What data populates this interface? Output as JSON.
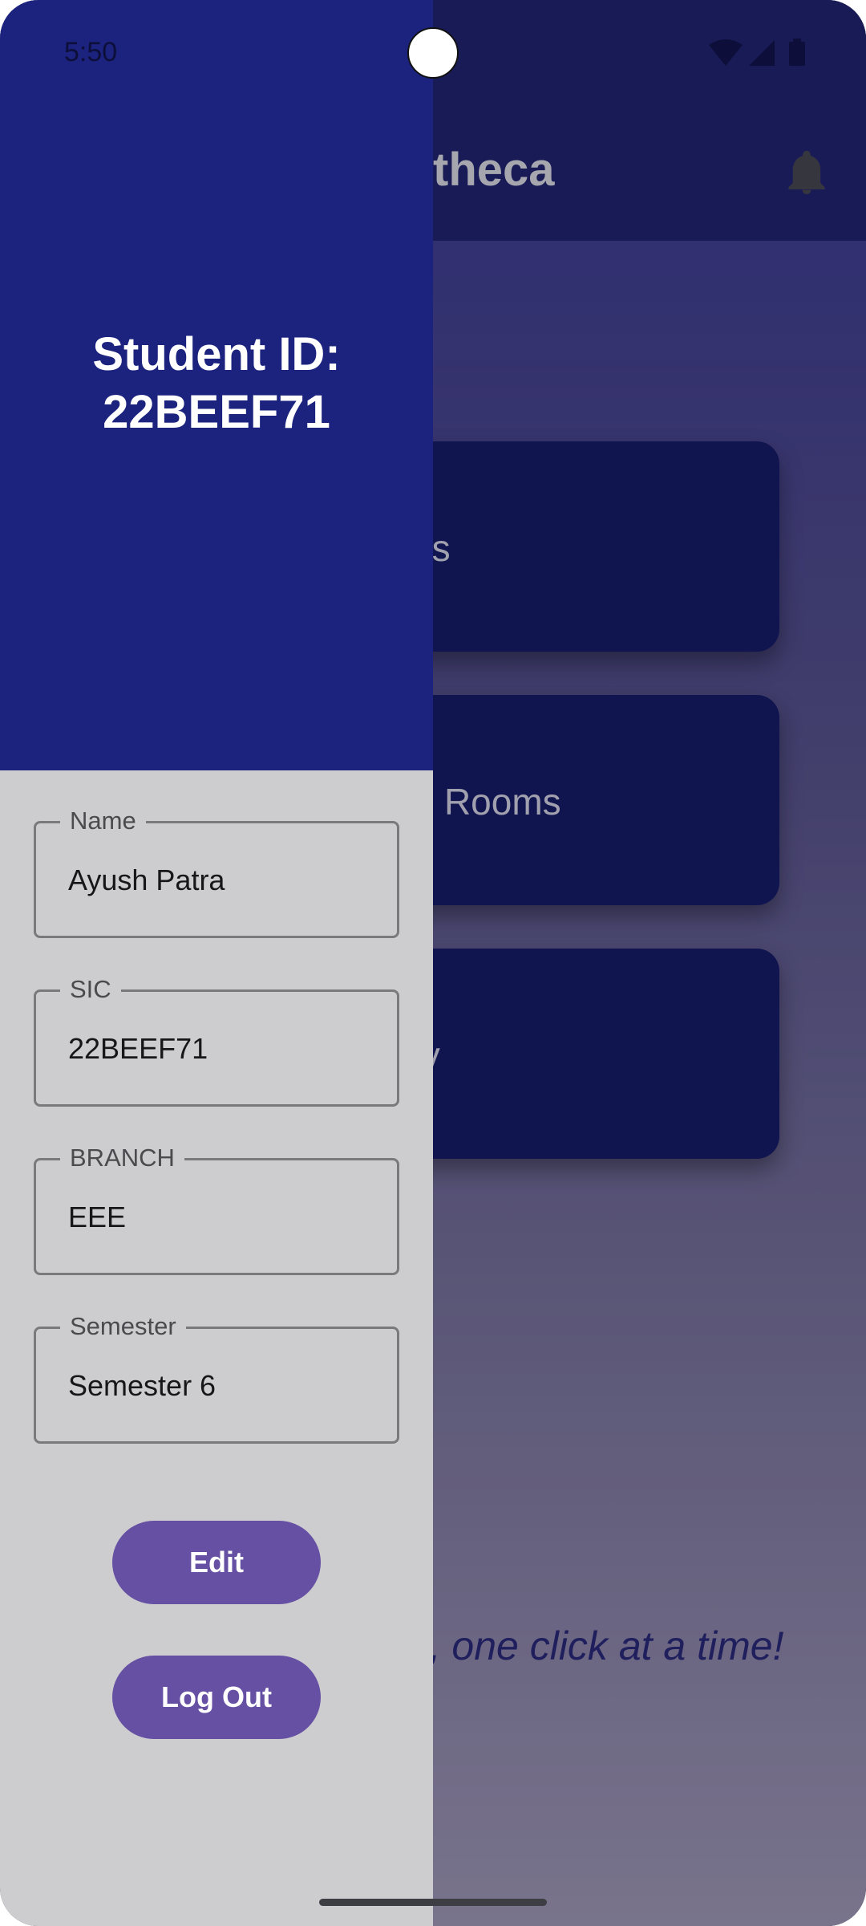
{
  "status_bar": {
    "time": "5:50",
    "icons": [
      "wifi-icon",
      "cellular-signal-icon",
      "battery-icon"
    ]
  },
  "app": {
    "title": "Bibliotheca",
    "visible_title_fragment": "theca",
    "cards": [
      {
        "label": "Books",
        "visible_fragment": "oks"
      },
      {
        "label": "Discussion Rooms",
        "visible_fragment": "on Rooms"
      },
      {
        "label": "Notify",
        "visible_fragment": "tify"
      }
    ],
    "tagline_fragment": "ge, one click at a time!",
    "notification_icon": "bell-icon"
  },
  "drawer": {
    "header_title": "Student ID: 22BEEF71",
    "header_line1": "Student ID:",
    "header_line2": "22BEEF71",
    "fields": [
      {
        "label": "Name",
        "value": "Ayush Patra"
      },
      {
        "label": "SIC",
        "value": "22BEEF71"
      },
      {
        "label": "BRANCH",
        "value": "EEE"
      },
      {
        "label": "Semester",
        "value": "Semester 6"
      }
    ],
    "edit_label": "Edit",
    "logout_label": "Log Out"
  },
  "colors": {
    "drawer_header": "#1b237e",
    "drawer_body": "#cdcdcf",
    "button": "#6650a4",
    "card": "#14185a"
  }
}
